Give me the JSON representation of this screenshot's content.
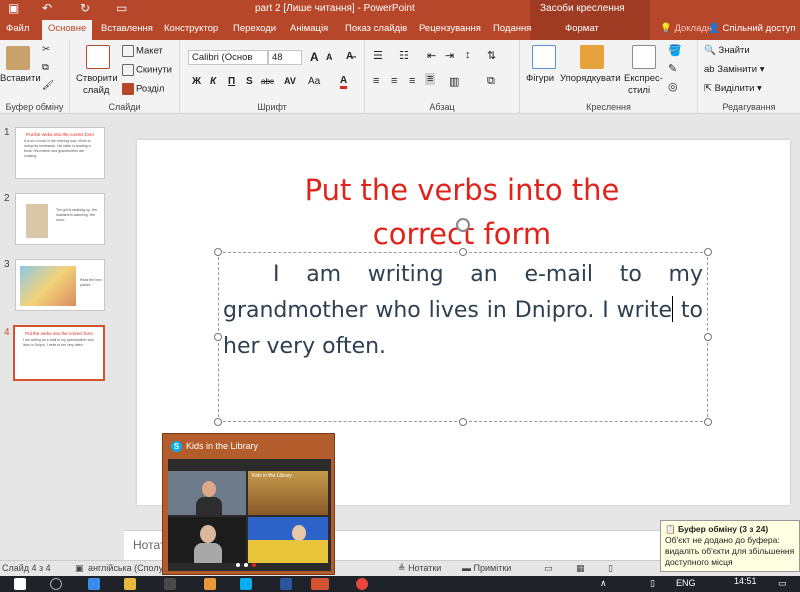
{
  "titlebar": {
    "title": "part 2 [Лише читання] - PowerPoint",
    "context_label": "Засоби креслення"
  },
  "tabs": [
    "Файл",
    "Основне",
    "Вставлення",
    "Конструктор",
    "Переходи",
    "Анімація",
    "Показ слайдів",
    "Рецензування",
    "Подання",
    "Формат"
  ],
  "tab_help": "Докладні",
  "tab_share": "Спільний доступ",
  "ribbon": {
    "clipboard": {
      "paste": "Вставити",
      "group": "Буфер обміну"
    },
    "slides": {
      "new_slide_1": "Створити",
      "new_slide_2": "слайд",
      "layout": "Макет",
      "reset": "Скинути",
      "section": "Розділ",
      "group": "Слайди"
    },
    "font": {
      "name": "Calibri (Основ",
      "size": "48",
      "bold": "Ж",
      "italic": "К",
      "underline": "П",
      "strike": "abc",
      "spacing": "AV",
      "case": "Aa",
      "color": "A",
      "grow": "A",
      "shrink": "A",
      "group": "Шрифт"
    },
    "paragraph": {
      "group": "Абзац"
    },
    "drawing": {
      "shapes": "Фігури",
      "arrange": "Упорядкувати",
      "quick_1": "Експрес-",
      "quick_2": "стилі",
      "group": "Креслення"
    },
    "editing": {
      "find": "Знайти",
      "replace": "Замінити",
      "select": "Виділити",
      "group": "Редагування"
    }
  },
  "thumbnails": [
    {
      "num": "1",
      "title": "Put the verbs into the correct form",
      "text": "It is six o'clock in the evening now. Victor is doing his homework. His sister is reading a book. His mother and grandmother are cooking."
    },
    {
      "num": "2",
      "text": "The girl is washing up. Her husband is watching. Her mum..."
    },
    {
      "num": "3",
      "text": "Read the new picture."
    },
    {
      "num": "4",
      "title": "Put the verbs into the correct form",
      "text": "I am writing an e-mail to my grandmother who lives in Dnipro. I write to her very often."
    }
  ],
  "slide": {
    "title_line1": "Put the verbs into the",
    "title_line2": "correct form",
    "body_before_cursor": "I am writing an e-mail to my grandmother who lives in Dnipro. I write",
    "body_after_cursor": " to her very often."
  },
  "notes_placeholder": "Нотат",
  "status": {
    "slide_info": "Слайд 4 з 4",
    "language": "англійська (Сполу",
    "notes": "Нотатки",
    "comments": "Примітки"
  },
  "skype": {
    "window_title": "Kids in the Library",
    "tile_label": "Kids in the Library"
  },
  "clipboard_notice": {
    "title": "Буфер обміну (3 з 24)",
    "message": "Об'єкт не додано до буфера: видаліть об'єкти для збільшення доступного місця"
  },
  "taskbar": {
    "lang": "ENG",
    "time": "14:51"
  },
  "colors": {
    "accent": "#b7472a",
    "title_red": "#e0241b",
    "selected_slide": "#d35230"
  }
}
